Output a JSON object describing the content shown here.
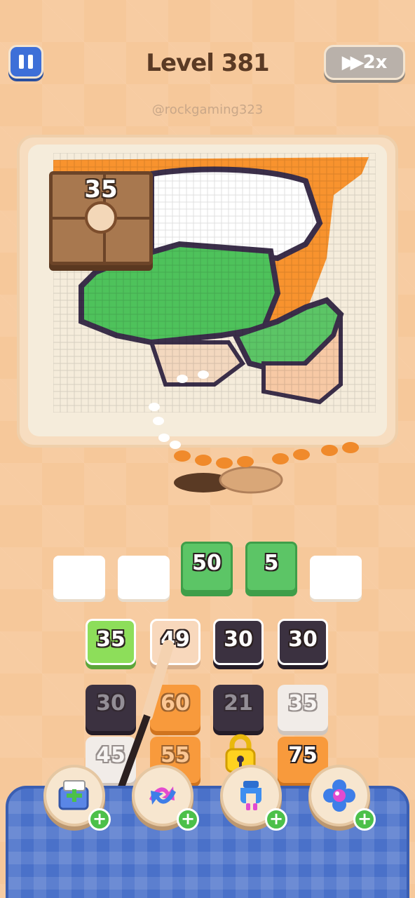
{
  "header": {
    "level_label": "Level 381",
    "speed_label": "2x",
    "watermark": "@rockgaming323"
  },
  "icons": {
    "pause": "pause-icon",
    "speed": "fast-forward-icon",
    "lock": "padlock-icon",
    "booster_1": "add-box-icon",
    "booster_2": "swap-arrows-icon",
    "booster_3": "magnet-claw-icon",
    "booster_4": "flower-icon"
  },
  "board": {
    "counter": "35"
  },
  "slots": [
    {
      "value": "",
      "filled": false
    },
    {
      "value": "",
      "filled": false
    },
    {
      "value": "50",
      "filled": true
    },
    {
      "value": "5",
      "filled": true
    },
    {
      "value": "",
      "filled": false
    }
  ],
  "tiles": {
    "row1": [
      "35",
      "49",
      "30",
      "30"
    ],
    "row2": [
      "30",
      "60",
      "21",
      "35"
    ],
    "row3": [
      "45",
      "55",
      "",
      "75"
    ]
  },
  "colors": {
    "background": "#f6c89a",
    "green": "#5cc566",
    "orange": "#f89a3c",
    "dark": "#3b3140",
    "tray_blue": "#4a71c9"
  }
}
